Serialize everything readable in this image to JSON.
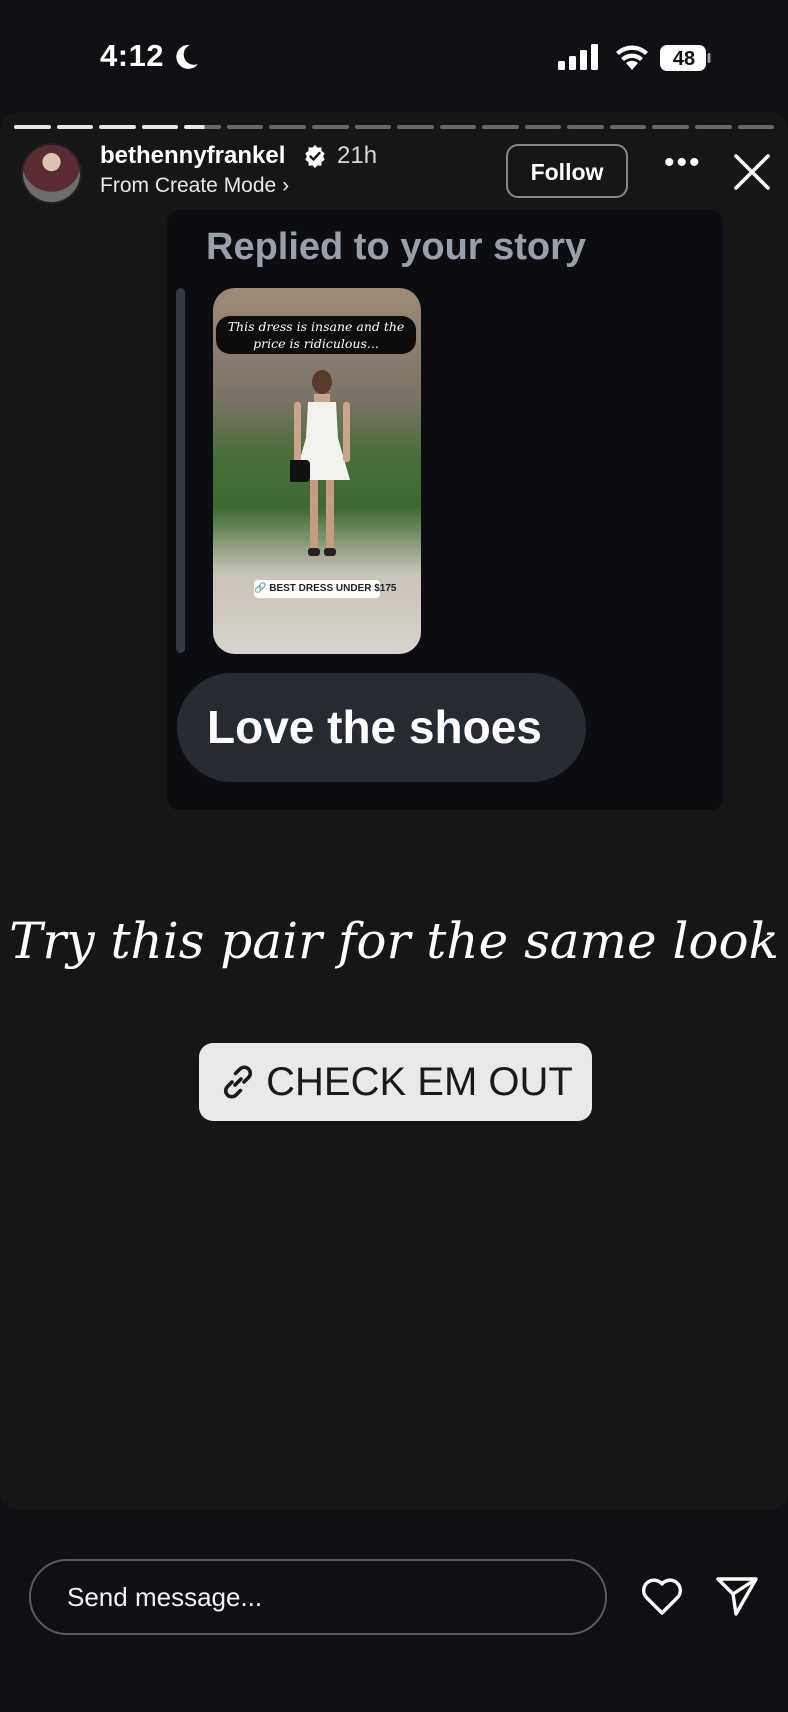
{
  "status_bar": {
    "time": "4:12",
    "battery": "48"
  },
  "story": {
    "progress": {
      "segments_total": 18,
      "segments_complete": 4,
      "current_segment_progress": 0.55
    },
    "username": "bethennyfrankel",
    "time_ago": "21h",
    "subtitle": "From Create Mode",
    "subtitle_chevron": "›",
    "follow_label": "Follow",
    "more_label": "•••",
    "reply": {
      "header": "Replied to your story",
      "photo_caption": "This dress is insane and the price is ridiculous...",
      "photo_link_label": "🔗 BEST DRESS UNDER $175",
      "message": "Love the shoes"
    },
    "caption": "Try this pair for the same look",
    "link_button_label": "CHECK EM OUT"
  },
  "bottom_bar": {
    "message_placeholder": "Send message..."
  },
  "colors": {
    "background": "#0e1013",
    "story_card": "#161616",
    "reply_panel": "#0b0d12",
    "bubble": "#262a31",
    "link_button": "#e9e9e9"
  },
  "icons": {
    "moon": "moon-icon",
    "signal": "cellular-signal-icon",
    "wifi": "wifi-icon",
    "battery": "battery-icon",
    "verified": "verified-badge-icon",
    "more": "more-options-icon",
    "close": "close-icon",
    "link": "link-icon",
    "heart": "heart-icon",
    "send": "send-icon"
  }
}
